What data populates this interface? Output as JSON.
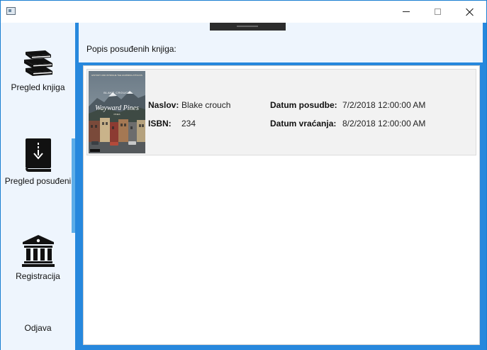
{
  "window": {
    "controls": {
      "minimize_icon": "minimize-icon",
      "maximize_icon": "maximize-icon",
      "close_icon": "close-icon"
    }
  },
  "sidebar": {
    "items": [
      {
        "label": "Pregled knjiga",
        "icon": "books-stack-icon"
      },
      {
        "label": "Pregled posuđeni",
        "icon": "book-download-icon"
      },
      {
        "label": "Registracija",
        "icon": "bank-building-icon"
      },
      {
        "label": "Odjava",
        "icon": ""
      }
    ],
    "active_index": 1
  },
  "main": {
    "title": "Popis posuđenih knjiga:",
    "books": [
      {
        "cover": {
          "top_text": "HISTORY AND INTRIGUE THE HUMMING ATTACKS",
          "author": "BLAKE CROUCH",
          "title": "Wayward Pines",
          "subtitle": "PINES"
        },
        "title_label": "Naslov:",
        "title_value": "Blake crouch",
        "isbn_label": "ISBN:",
        "isbn_value": "234",
        "borrow_date_label": "Datum posudbe:",
        "borrow_date_value": "7/2/2018 12:00:00 AM",
        "return_date_label": "Datum vraćanja:",
        "return_date_value": "8/2/2018 12:00:00 AM"
      }
    ]
  },
  "colors": {
    "accent": "#2788dd",
    "sidebar_bg": "#eef5fd",
    "sidebar_active": "#5dade8"
  }
}
